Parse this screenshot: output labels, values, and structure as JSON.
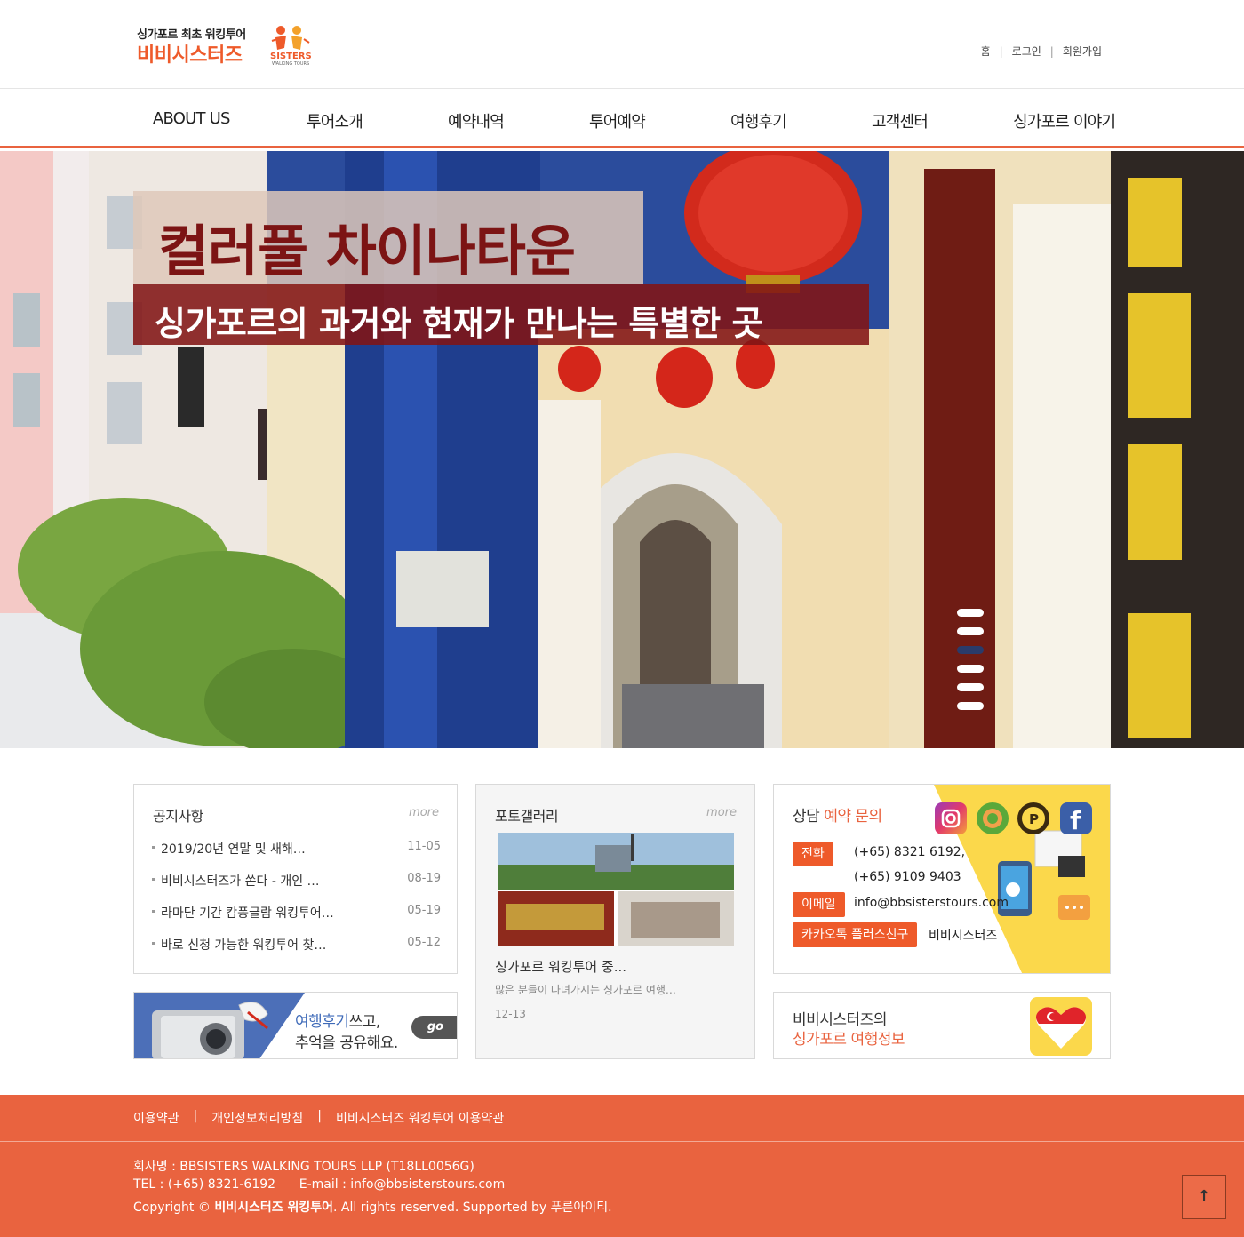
{
  "header": {
    "logo_tagline": "싱가포르 최초 워킹투어",
    "logo_name": "비비시스터즈",
    "logo_mark_text": "SISTERS",
    "logo_mark_sub": "WALKING TOURS",
    "utility_links": [
      "홈",
      "로그인",
      "회원가입"
    ]
  },
  "nav": {
    "items": [
      "ABOUT US",
      "투어소개",
      "예약내역",
      "투어예약",
      "여행후기",
      "고객센터",
      "싱가포르 이야기"
    ]
  },
  "hero": {
    "title": "컬러풀 차이나타운",
    "subtitle": "싱가포르의 과거와 현재가 만나는 특별한 곳",
    "slide_count": 6,
    "active_slide": 3
  },
  "notice": {
    "title": "공지사항",
    "more_label": "more",
    "items": [
      {
        "title": "2019/20년 연말 및 새해…",
        "date": "11-05"
      },
      {
        "title": "비비시스터즈가 쏜다 - 개인 …",
        "date": "08-19"
      },
      {
        "title": "라마단 기간 캄퐁글람 워킹투어…",
        "date": "05-19"
      },
      {
        "title": "바로 신청 가능한 워킹투어 찾…",
        "date": "05-12"
      }
    ]
  },
  "gallery": {
    "title": "포토갤러리",
    "more_label": "more",
    "post_title": "싱가포르 워킹투어 중...",
    "post_desc": "많은 분들이 다녀가시는 싱가포르 여행…",
    "post_date": "12-13"
  },
  "contact": {
    "title_prefix": "상담",
    "title_highlight": "예약 문의",
    "phone_label": "전화",
    "phone_1": "(+65) 8321 6192,",
    "phone_2": "(+65) 9109 9403",
    "email_label": "이메일",
    "email": "info@bbsisterstours.com",
    "kakao_label": "카카오톡 플러스친구",
    "kakao_value": "비비시스터즈",
    "social_icons": [
      "instagram-icon",
      "kakao-story-icon",
      "kakao-plus-icon",
      "facebook-icon"
    ]
  },
  "review_banner": {
    "line1_highlight": "여행후기",
    "line1_rest": "쓰고,",
    "line2": "추억을 공유해요.",
    "go_label": "go"
  },
  "info_banner": {
    "line1": "비비시스터즈의",
    "line2": "싱가포르 여행정보"
  },
  "footer": {
    "links": [
      "이용약관",
      "개인정보처리방침",
      "비비시스터즈 워킹투어 이용약관"
    ],
    "separator": "|",
    "company": "회사명 : BBSISTERS WALKING TOURS LLP (T18LL0056G)",
    "contact": "TEL : (+65) 8321-6192      E-mail : info@bbsisterstours.com",
    "copyright_prefix": "Copyright ©",
    "copyright_brand": "비비시스터즈 워킹투어",
    "copyright_rest": ". All rights reserved. Supported by 푸른아이티.",
    "top_label": "↑"
  },
  "colors": {
    "accent": "#e9633f",
    "hero_title": "#7c1414",
    "hero_sub_bg": "#821414",
    "contact_yellow": "#fbd84b"
  }
}
